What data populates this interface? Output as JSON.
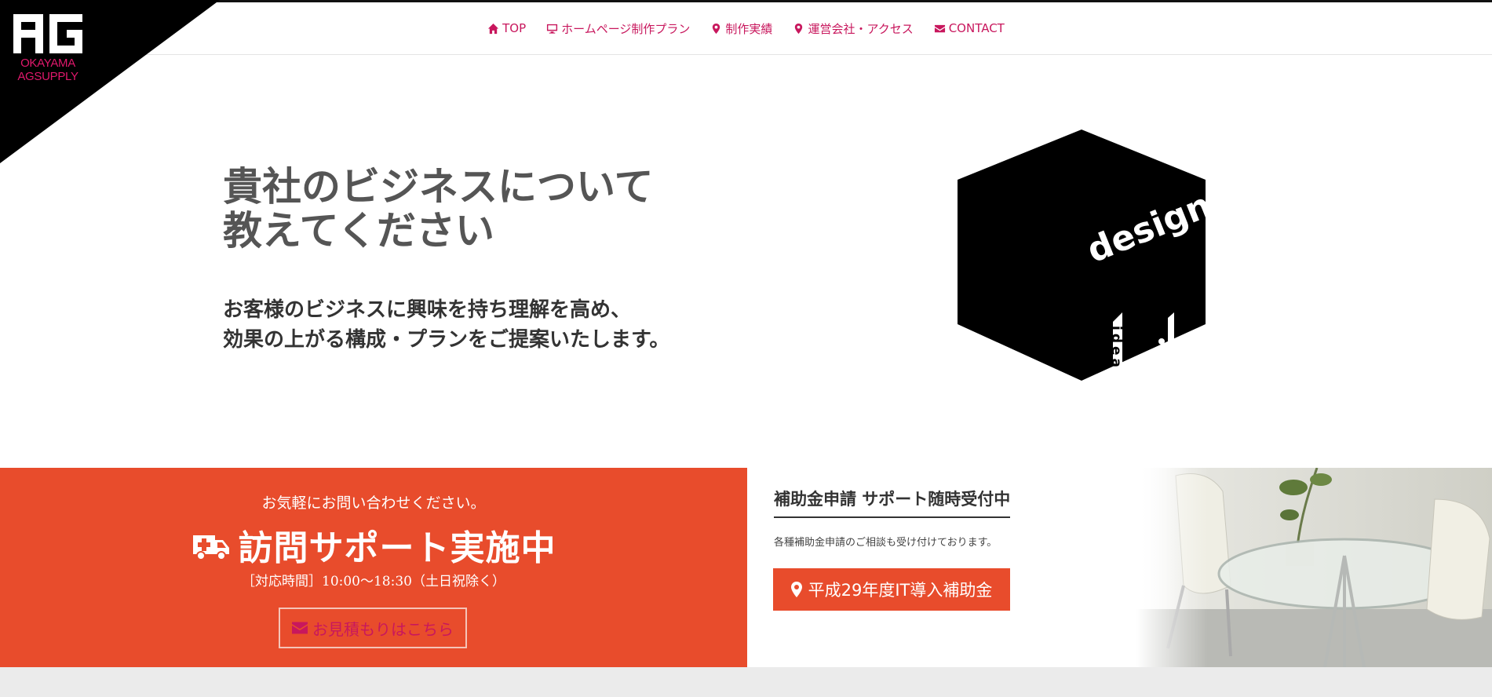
{
  "logo": {
    "mark": "AG",
    "line1": "OKAYAMA",
    "line2": "AGSUPPLY"
  },
  "nav": {
    "items": [
      {
        "label": "TOP",
        "icon": "home-icon"
      },
      {
        "label": "ホームページ制作プラン",
        "icon": "monitor-icon"
      },
      {
        "label": "制作実績",
        "icon": "map-pin-icon"
      },
      {
        "label": "運営会社・アクセス",
        "icon": "map-pin-icon"
      },
      {
        "label": "CONTACT",
        "icon": "envelope-icon"
      }
    ]
  },
  "hero": {
    "title_line1": "貴社のビジネスについて",
    "title_line2": "教えてください",
    "sub_line1": "お客様のビジネスに興味を持ち理解を高め、",
    "sub_line2": "効果の上がる構成・プランをご提案いたします。",
    "cube_word1": "design",
    "cube_word2": "idea"
  },
  "contact_panel": {
    "lead": "お気軽にお問い合わせください。",
    "title": "訪問サポート実施中",
    "hours": "［対応時間］10:00～18:30（土日祝除く）",
    "button_label": "お見積もりはこちら",
    "background_color": "#e84c2c"
  },
  "subsidy_panel": {
    "title": "補助金申請 サポート随時受付中",
    "text": "各種補助金申請のご相談も受け付けております。",
    "button_label": "平成29年度IT導入補助金"
  },
  "colors": {
    "accent": "#c8175d",
    "orange": "#e84c2c"
  }
}
